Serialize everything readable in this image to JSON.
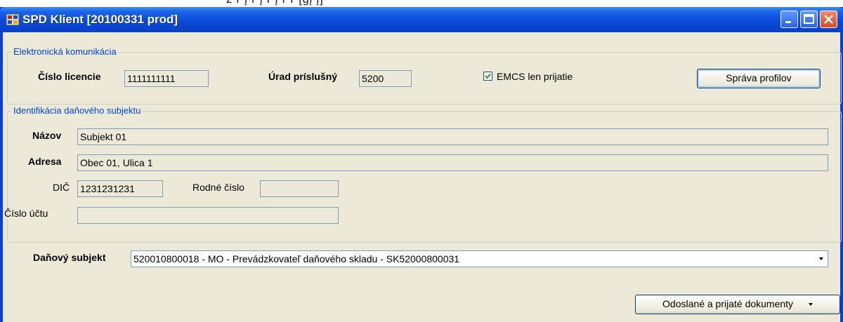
{
  "window": {
    "title": "SPD Klient [20100331 prod]",
    "controls": {
      "minimize": "minimize",
      "maximize": "maximize",
      "close": "close"
    }
  },
  "top_strip_text": "ž ř į ř į ř į ř ŕ [ġį į]",
  "komunikacia": {
    "group_label": "Elektronická komunikácia",
    "licencia_label": "Číslo licencie",
    "licencia_value": "1111111111",
    "urad_label": "Úrad príslušný",
    "urad_value": "5200",
    "emcs_label": "EMCS len prijatie",
    "emcs_checked": true,
    "sprava_button": "Správa profilov"
  },
  "identifikacia": {
    "group_label": "Identifikácia daňového subjektu",
    "nazov_label": "Názov",
    "nazov_value": "Subjekt 01",
    "adresa_label": "Adresa",
    "adresa_value": "Obec 01, Ulica 1",
    "dic_label": "DIČ",
    "dic_value": "1231231231",
    "rodne_label": "Rodné číslo",
    "rodne_value": "",
    "ucet_label": "Číslo účtu",
    "ucet_value": ""
  },
  "danovy_subjekt": {
    "label": "Daňový subjekt",
    "selected": "520010800018 - MO - Prevádzkovateľ daňového skladu - SK52000800031"
  },
  "documents_button": "Odoslané a prijaté dokumenty",
  "colors": {
    "title_bar": "#0a4bd8",
    "client_bg": "#ece9d8",
    "group_label": "#0046d5",
    "close_button": "#d94a26"
  }
}
